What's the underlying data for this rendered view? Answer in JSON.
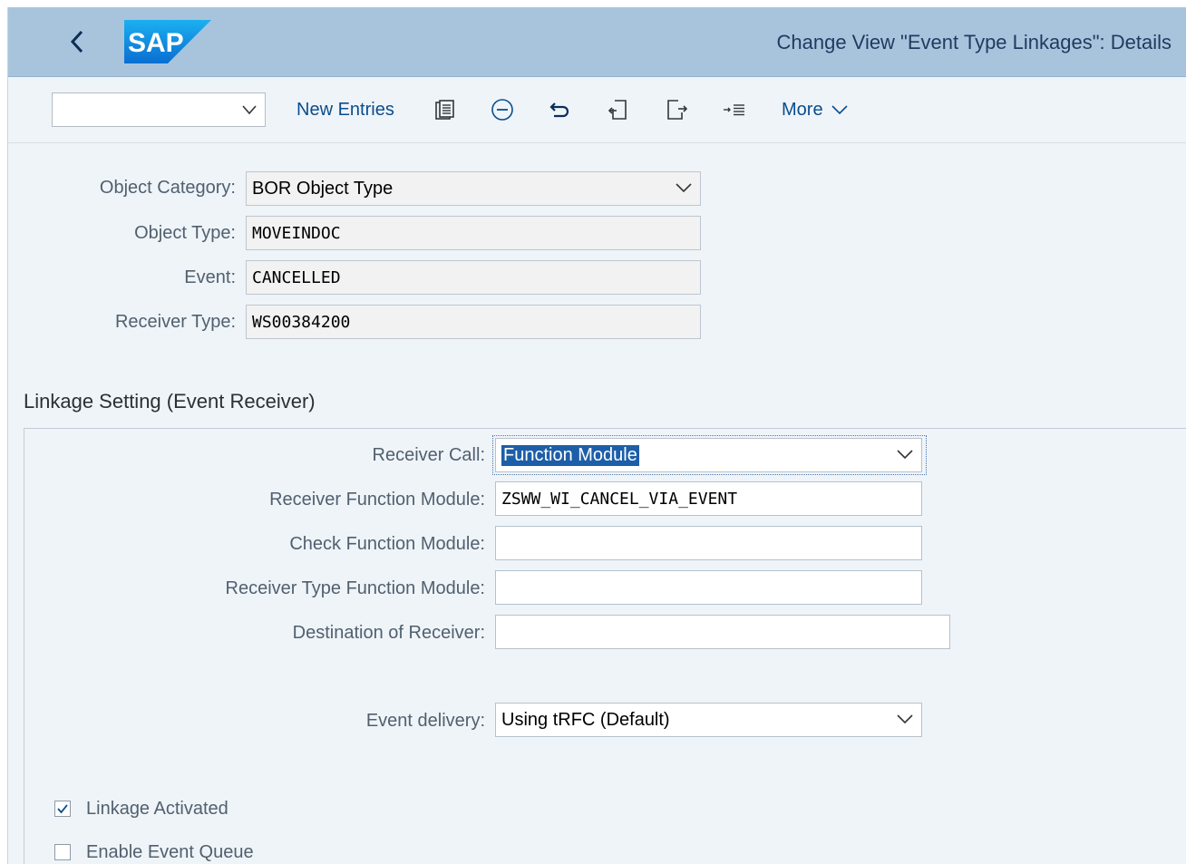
{
  "shell": {
    "title": "Change View \"Event Type Linkages\": Details",
    "logo_text": "SAP",
    "brand_color": "#0a6ed1"
  },
  "toolbar": {
    "dropdown_value": "",
    "new_entries_label": "New Entries",
    "more_label": "More",
    "icons": [
      "details-icon",
      "delete-icon",
      "undo-icon",
      "previous-entry-icon",
      "next-entry-icon",
      "select-all-icon"
    ]
  },
  "header_fields": {
    "object_category_label": "Object Category:",
    "object_category_value": "BOR Object Type",
    "object_type_label": "Object Type:",
    "object_type_value": "MOVEINDOC",
    "event_label": "Event:",
    "event_value": "CANCELLED",
    "receiver_type_label": "Receiver Type:",
    "receiver_type_value": "WS00384200"
  },
  "linkage": {
    "section_title": "Linkage Setting (Event Receiver)",
    "receiver_call_label": "Receiver Call:",
    "receiver_call_value": "Function Module",
    "receiver_fm_label": "Receiver Function Module:",
    "receiver_fm_value": "ZSWW_WI_CANCEL_VIA_EVENT",
    "check_fm_label": "Check Function Module:",
    "check_fm_value": "",
    "receiver_type_fm_label": "Receiver Type Function Module:",
    "receiver_type_fm_value": "",
    "destination_label": "Destination of Receiver:",
    "destination_value": "",
    "event_delivery_label": "Event delivery:",
    "event_delivery_value": "Using tRFC (Default)",
    "linkage_activated_label": "Linkage Activated",
    "linkage_activated": true,
    "enable_event_queue_label": "Enable Event Queue",
    "enable_event_queue": false
  }
}
